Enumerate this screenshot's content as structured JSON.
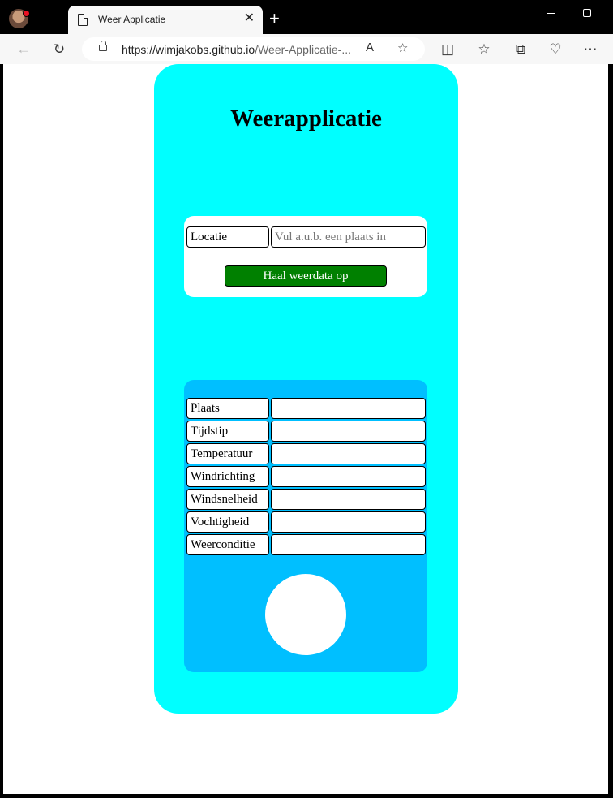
{
  "browser": {
    "tab_title": "Weer Applicatie",
    "url_host": "https://wimjakobs.github.io",
    "url_path": "/Weer-Applicatie-..."
  },
  "app": {
    "title": "Weerapplicatie",
    "colors": {
      "background": "#00ffff",
      "card": "#ffffff",
      "results": "#00bfff",
      "button": "#008000"
    },
    "search": {
      "label": "Locatie",
      "placeholder": "Vul a.u.b. een plaats in",
      "value": "",
      "button_label": "Haal weerdata op"
    },
    "results": [
      {
        "label": "Plaats",
        "value": ""
      },
      {
        "label": "Tijdstip",
        "value": ""
      },
      {
        "label": "Temperatuur",
        "value": ""
      },
      {
        "label": "Windrichting",
        "value": ""
      },
      {
        "label": "Windsnelheid",
        "value": ""
      },
      {
        "label": "Vochtigheid",
        "value": ""
      },
      {
        "label": "Weerconditie",
        "value": ""
      }
    ]
  }
}
